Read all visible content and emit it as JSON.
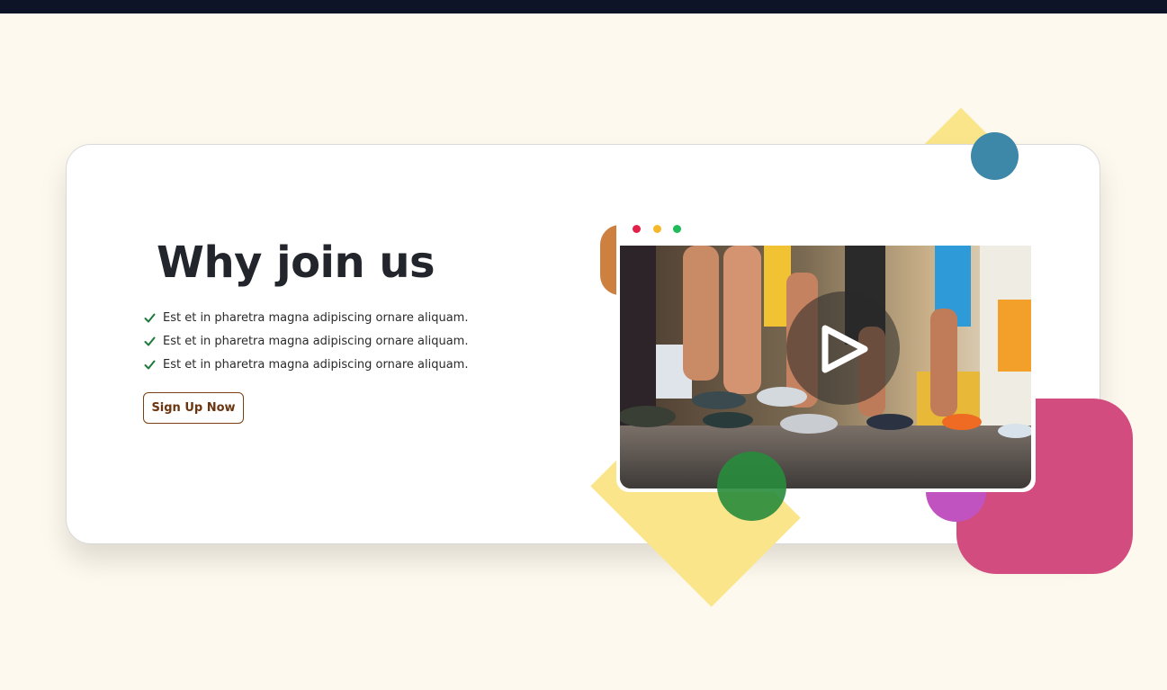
{
  "section": {
    "heading": "Why join us",
    "features": [
      "Est et in pharetra magna adipiscing ornare aliquam.",
      "Est et in pharetra magna adipiscing ornare aliquam.",
      "Est et in pharetra magna adipiscing ornare aliquam."
    ],
    "cta_label": "Sign Up Now"
  },
  "video": {
    "window_dots": [
      "red",
      "yellow",
      "green"
    ],
    "play_icon": "play-icon",
    "thumbnail": "runners-legs-on-street"
  },
  "colors": {
    "topbar": "#0d1428",
    "page_background": "#fdf9ee",
    "heading": "#22252b",
    "check": "#1c7a3a",
    "cta_border": "#7a3f12",
    "yellow_shape": "#fbe58a",
    "blue_circle": "#3d88a8",
    "orange_shape": "#cd8040",
    "pink_shape": "#d24c7f",
    "purple_circle": "#c053c0",
    "green_circle": "#2a8c3c"
  }
}
